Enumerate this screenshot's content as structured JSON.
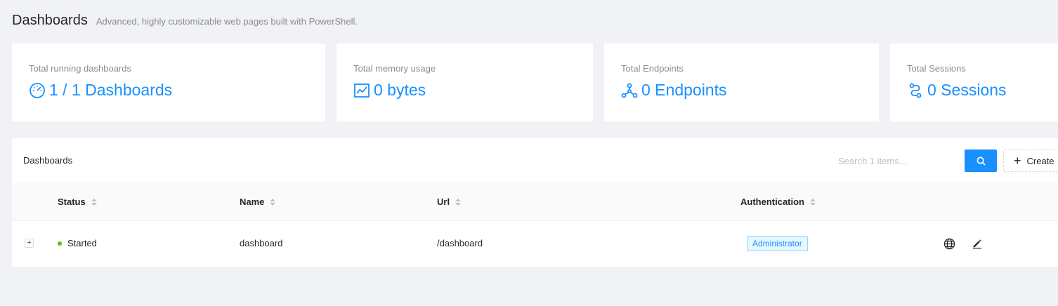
{
  "header": {
    "title": "Dashboards",
    "subtitle": "Advanced, highly customizable web pages built with PowerShell."
  },
  "stats": [
    {
      "label": "Total running dashboards",
      "value": "1 / 1 Dashboards",
      "icon": "dashboard-gauge-icon"
    },
    {
      "label": "Total memory usage",
      "value": "0 bytes",
      "icon": "line-chart-icon"
    },
    {
      "label": "Total Endpoints",
      "value": "0 Endpoints",
      "icon": "endpoints-network-icon"
    },
    {
      "label": "Total Sessions",
      "value": "0 Sessions",
      "icon": "sessions-icon"
    }
  ],
  "table": {
    "title": "Dashboards",
    "search_placeholder": "Search 1 items...",
    "create_label": "Create",
    "columns": [
      "Status",
      "Name",
      "Url",
      "Authentication"
    ],
    "rows": [
      {
        "status": "Started",
        "name": "dashboard",
        "url": "/dashboard",
        "authentication": "Administrator"
      }
    ]
  },
  "colors": {
    "accent": "#1890ff",
    "status_started": "#52c41a",
    "background": "#f0f2f5"
  }
}
